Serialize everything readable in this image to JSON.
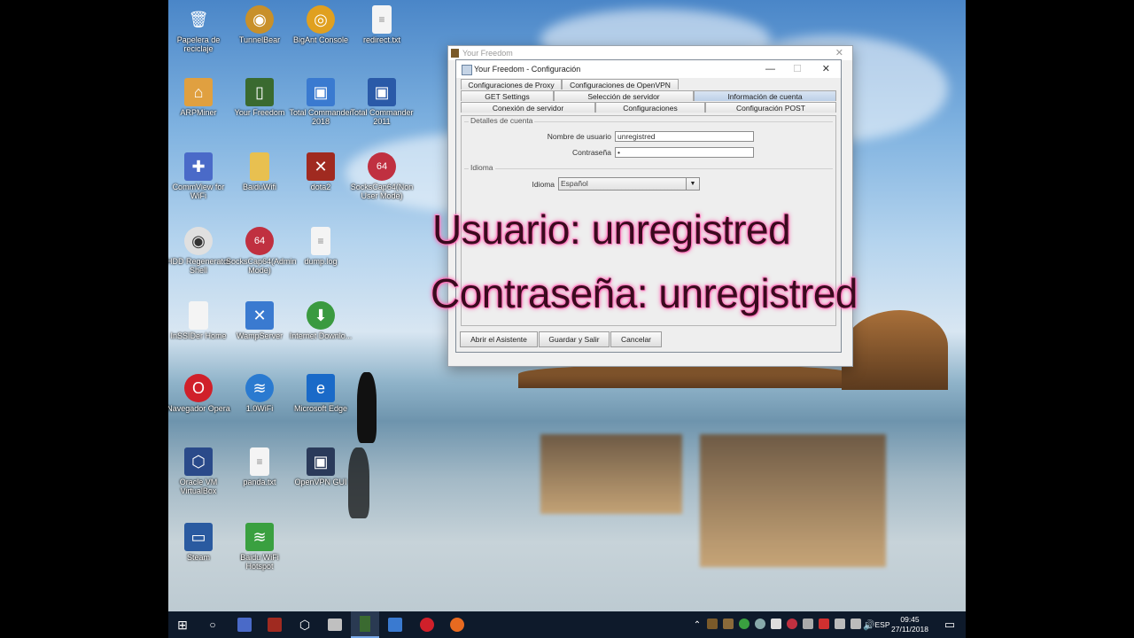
{
  "desktop_icons": [
    {
      "label": "Papelera de reciclaje",
      "icon": "recycle-bin-icon",
      "color": "#9ec1e0"
    },
    {
      "label": "TunnelBear",
      "icon": "bear-icon",
      "color": "#c8902a"
    },
    {
      "label": "BigAnt Console",
      "icon": "bigant-icon",
      "color": "#e0a020"
    },
    {
      "label": "redirect.txt",
      "icon": "text-file-icon",
      "color": "#f4f4f4"
    },
    {
      "label": "ARPMiner",
      "icon": "house-icon",
      "color": "#e0a040"
    },
    {
      "label": "Your Freedom",
      "icon": "door-icon",
      "color": "#3a6a30"
    },
    {
      "label": "Total Commander 2018",
      "icon": "floppy-icon",
      "color": "#3a7ad0"
    },
    {
      "label": "Total Commander 2011",
      "icon": "floppy-icon",
      "color": "#2a5aa8"
    },
    {
      "label": "CommView for WiFi",
      "icon": "commview-icon",
      "color": "#4a6ac8"
    },
    {
      "label": "BaiduWifi",
      "icon": "folder-icon",
      "color": "#e8c050"
    },
    {
      "label": "dota2",
      "icon": "dota-icon",
      "color": "#a02a20"
    },
    {
      "label": "SocksCap64(Non User Mode)",
      "icon": "sockscap-icon",
      "color": "#c03040"
    },
    {
      "label": "HDD Regenerator Shell",
      "icon": "disk-icon",
      "color": "#e0e0e0"
    },
    {
      "label": "SocksCap64(Admin Mode)",
      "icon": "sockscap-icon",
      "color": "#c03040"
    },
    {
      "label": "dump.log",
      "icon": "text-file-icon",
      "color": "#f4f4f4"
    },
    {
      "label": "InSSIDer Home",
      "icon": "blank-file-icon",
      "color": "#f4f4f4"
    },
    {
      "label": "WampServer",
      "icon": "wamp-icon",
      "color": "#3a7ad0"
    },
    {
      "label": "Internet Downlo...",
      "icon": "idm-icon",
      "color": "#3a9a40"
    },
    {
      "label": "Navegador Opera",
      "icon": "opera-icon",
      "color": "#d0202a"
    },
    {
      "label": "1.0WiFi",
      "icon": "wifi-icon",
      "color": "#2a7ad0"
    },
    {
      "label": "Microsoft Edge",
      "icon": "edge-icon",
      "color": "#1a6ac8"
    },
    {
      "label": "Oracle VM VirtualBox",
      "icon": "virtualbox-icon",
      "color": "#2a4a8a"
    },
    {
      "label": "panda.txt",
      "icon": "text-file-icon",
      "color": "#f4f4f4"
    },
    {
      "label": "OpenVPN GUI",
      "icon": "openvpn-icon",
      "color": "#2a3a5a"
    },
    {
      "label": "Steam",
      "icon": "steam-icon",
      "color": "#2a5aa0"
    },
    {
      "label": "Baidu WiFi Hotspot",
      "icon": "wifi-hotspot-icon",
      "color": "#3aa040"
    }
  ],
  "back_window": {
    "title": "Your Freedom"
  },
  "config_window": {
    "title": "Your Freedom - Configuración",
    "tabs_row1": [
      "Configuraciones de Proxy",
      "Configuraciones de OpenVPN"
    ],
    "tabs_row2": [
      "GET Settings",
      "Selección de servidor",
      "Información de cuenta"
    ],
    "tabs_row3": [
      "Conexión de servidor",
      "Configuraciones",
      "Configuración POST"
    ],
    "selected_tab": "Información de cuenta",
    "account_group": {
      "title": "Detalles de cuenta",
      "username_label": "Nombre de usuario",
      "username_value": "unregistred",
      "password_label": "Contraseña",
      "password_value": "•"
    },
    "language_group": {
      "title": "Idioma",
      "language_label": "Idioma",
      "language_value": "Español"
    },
    "buttons": {
      "wizard": "Abrir el Asistente",
      "save_exit": "Guardar y Salir",
      "cancel": "Cancelar"
    }
  },
  "overlay": {
    "line1": "Usuario: unregistred",
    "line2": "Contraseña: unregistred"
  },
  "taskbar": {
    "clock_time": "09:45",
    "clock_date": "27/11/2018",
    "language": "ESP"
  }
}
